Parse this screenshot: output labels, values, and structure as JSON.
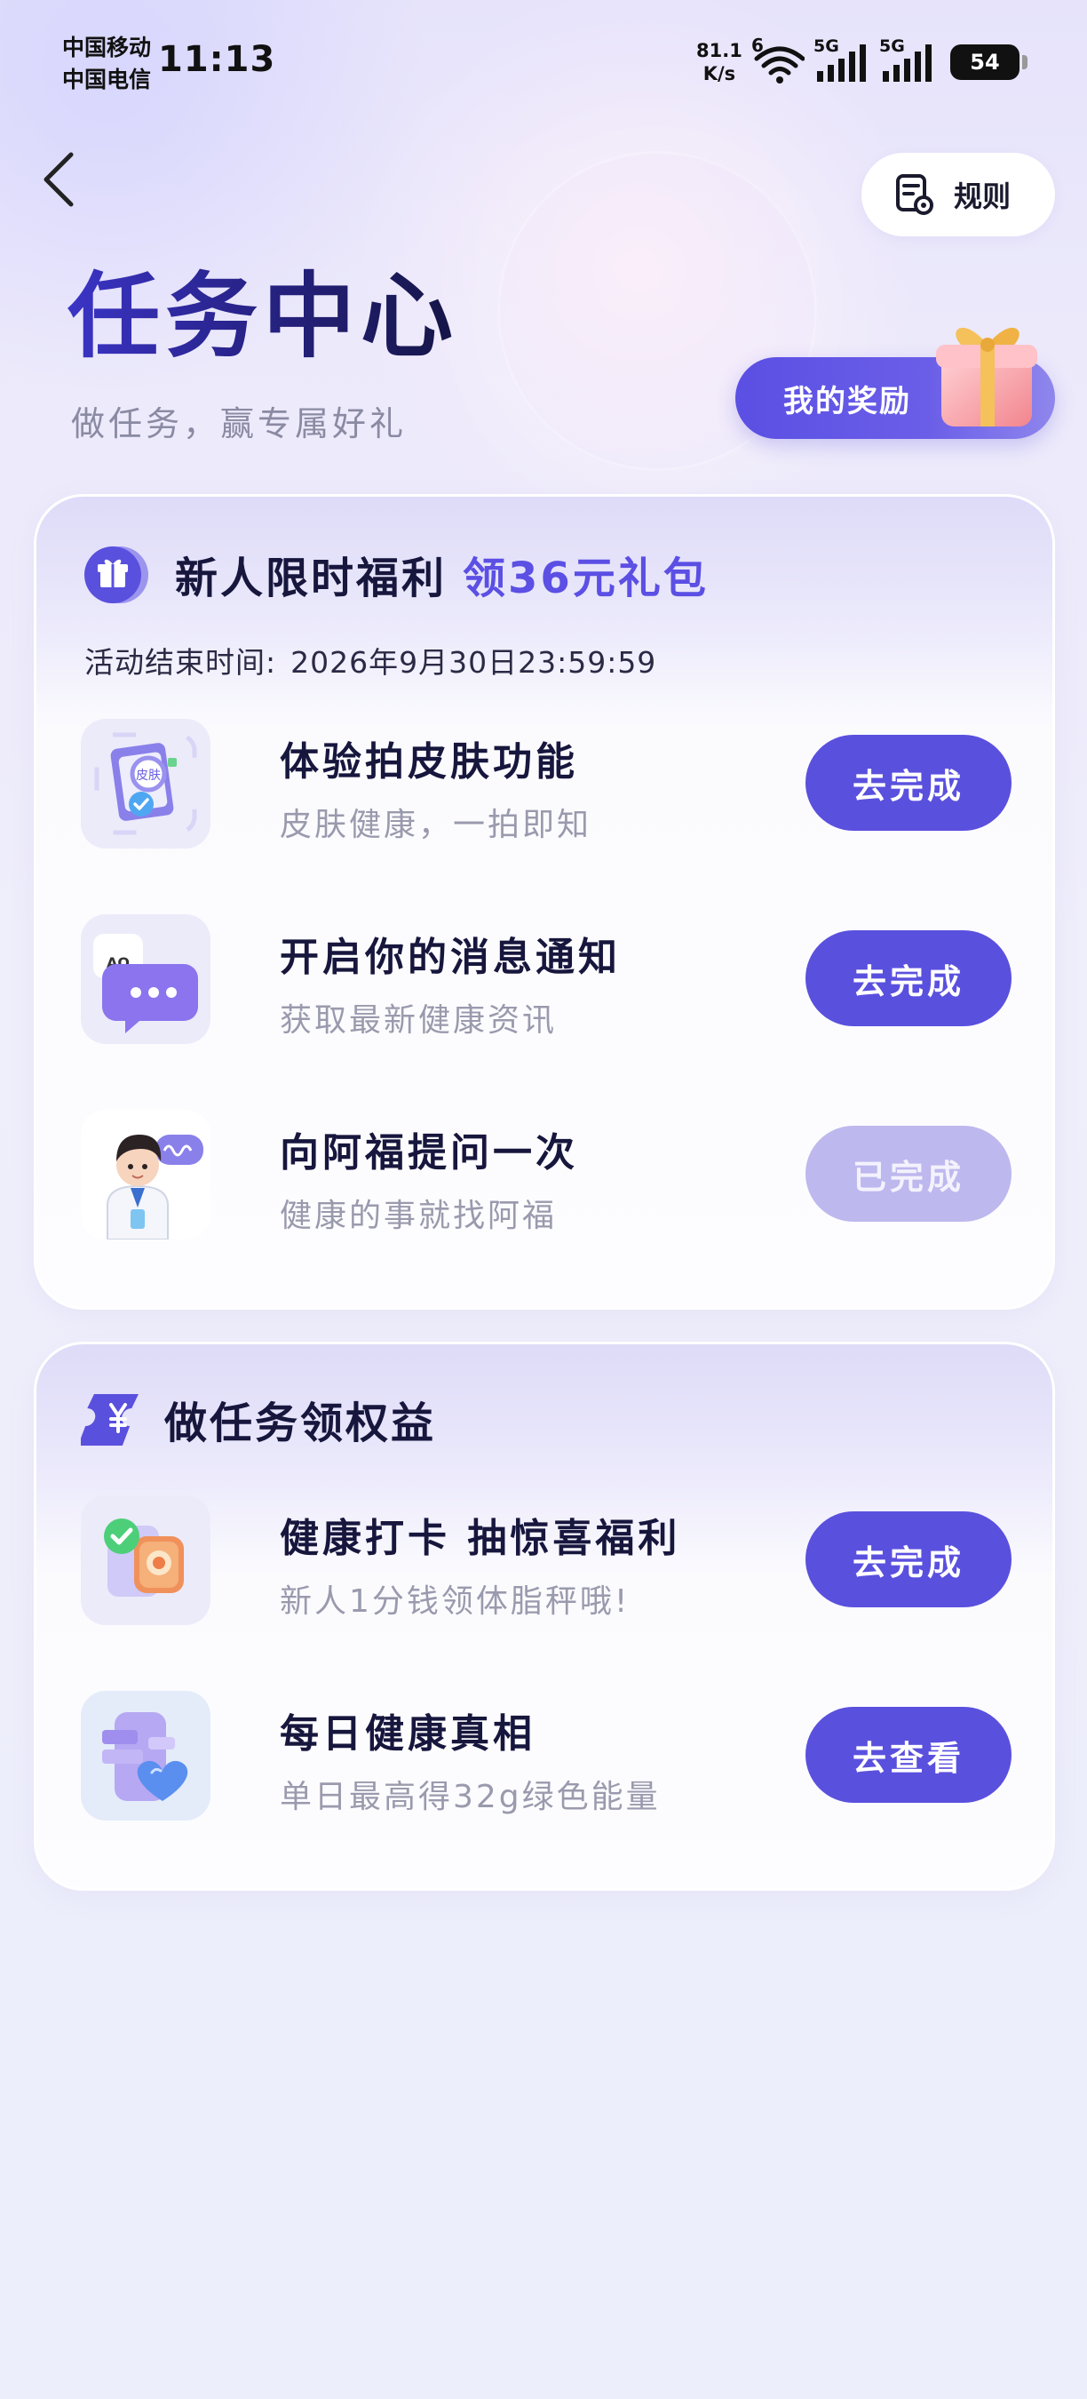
{
  "status_bar": {
    "carrier_1": "中国移动",
    "carrier_2": "中国电信",
    "time": "11:13",
    "net_speed_value": "81.1",
    "net_speed_unit": "K/s",
    "wifi_label": "6",
    "signal_1_label": "5G",
    "signal_2_label": "5G",
    "battery": "54"
  },
  "header": {
    "rules_label": "规则",
    "title": "任务中心",
    "subtitle": "做任务，赢专属好礼",
    "my_rewards_label": "我的奖励"
  },
  "newcomer_section": {
    "title": "新人限时福利",
    "highlight": "领36元礼包",
    "end_time_label": "活动结束时间:",
    "end_time_value": "2026年9月30日23:59:59",
    "tasks": [
      {
        "title": "体验拍皮肤功能",
        "desc": "皮肤健康，一拍即知",
        "button": "去完成",
        "completed": false,
        "icon": "skin-scan-icon",
        "icon_text": "皮肤"
      },
      {
        "title": "开启你的消息通知",
        "desc": "获取最新健康资讯",
        "button": "去完成",
        "completed": false,
        "icon": "message-notification-icon",
        "icon_text": "AQ"
      },
      {
        "title": "向阿福提问一次",
        "desc": "健康的事就找阿福",
        "button": "已完成",
        "completed": true,
        "icon": "doctor-avatar-icon"
      }
    ]
  },
  "benefits_section": {
    "title": "做任务领权益",
    "tasks": [
      {
        "title": "健康打卡 抽惊喜福利",
        "desc": "新人1分钱领体脂秤哦!",
        "button": "去完成",
        "completed": false,
        "icon": "checkin-gift-icon"
      },
      {
        "title": "每日健康真相",
        "desc": "单日最高得32g绿色能量",
        "button": "去查看",
        "completed": false,
        "icon": "daily-truth-heart-icon"
      }
    ]
  },
  "colors": {
    "primary": "#5a50de",
    "completed_button": "#bdb8ee",
    "title_text": "#17163d",
    "desc_text": "#9a9aae"
  }
}
